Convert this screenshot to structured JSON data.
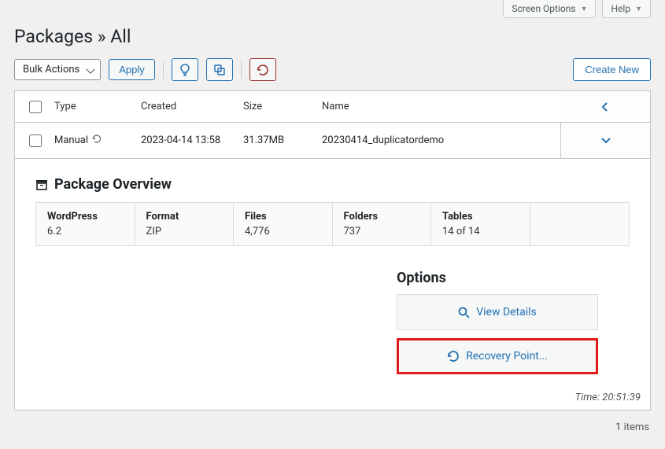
{
  "topbar": {
    "screen_options": "Screen Options",
    "help": "Help"
  },
  "page": {
    "title": "Packages » All"
  },
  "toolbar": {
    "bulk": "Bulk Actions",
    "apply": "Apply",
    "create": "Create New"
  },
  "table": {
    "headers": {
      "type": "Type",
      "created": "Created",
      "size": "Size",
      "name": "Name"
    },
    "row": {
      "type": "Manual",
      "created": "2023-04-14 13:58",
      "size": "31.37MB",
      "name": "20230414_duplicatordemo"
    }
  },
  "overview": {
    "heading": "Package Overview",
    "stats": {
      "wordpress_l": "WordPress",
      "wordpress_v": "6.2",
      "format_l": "Format",
      "format_v": "ZIP",
      "files_l": "Files",
      "files_v": "4,776",
      "folders_l": "Folders",
      "folders_v": "737",
      "tables_l": "Tables",
      "tables_v": "14 of 14"
    }
  },
  "options": {
    "heading": "Options",
    "view": "View Details",
    "recovery": "Recovery Point..."
  },
  "footer": {
    "time": "Time: 20:51:39",
    "count": "1 items"
  }
}
